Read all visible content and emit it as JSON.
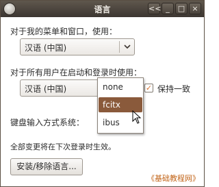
{
  "window": {
    "title": "语言",
    "buttons": [
      "<<",
      "_",
      "□",
      "×"
    ]
  },
  "menus_label": "对于我的菜单和窗口，使用：",
  "menus_combo_value": "汉语 (中国)",
  "all_users_label": "对于所有用户在启动和登录时使用：",
  "all_users_combo_value": "汉语 (中国)",
  "keep_same": {
    "label": "保持一致",
    "checked": true
  },
  "input_method_label": "键盘输入方式系统：",
  "input_method_options": [
    "none",
    "fcitx",
    "ibus"
  ],
  "input_method_selected": "fcitx",
  "note": "全部变更将在下次登录时生效。",
  "install_button_label": "安装/移除语言...",
  "watermark": "《基础教程网》",
  "colors": {
    "titlebar": "#3c3631",
    "selection": "#8a5a3b",
    "checkmark": "#d36f2f",
    "watermark": "#c26418"
  },
  "icons": {
    "dropdown": "chevron-down-icon",
    "cursor": "mouse-pointer-icon",
    "window_menu": "window-menu-icon"
  }
}
